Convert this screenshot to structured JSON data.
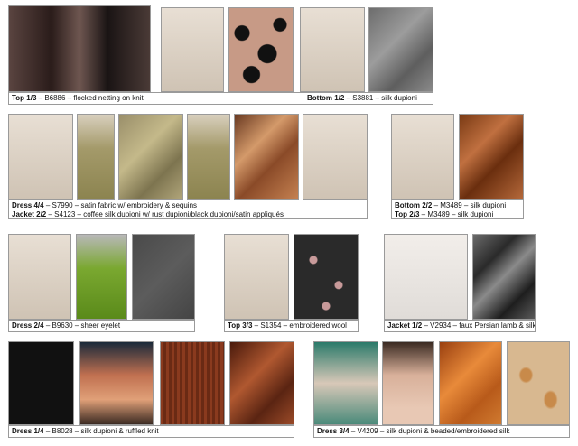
{
  "captions": {
    "top13": {
      "bold": "Top 1/3",
      "rest": " – B6886 – flocked netting on knit"
    },
    "bottom12": {
      "bold": "Bottom 1/2",
      "rest": " – S3881 – silk dupioni"
    },
    "dress44": {
      "bold": "Dress 4/4",
      "rest": " – S7990 – satin fabric w/ embroidery & sequins"
    },
    "jacket22": {
      "bold": "Jacket 2/2",
      "rest": " – S4123 – coffee silk dupioni w/ rust dupioni/black dupioni/satin appliqués"
    },
    "bottom22": {
      "bold": "Bottom 2/2",
      "rest": " – M3489 – silk dupioni"
    },
    "top23": {
      "bold": "Top 2/3",
      "rest": " – M3489 – silk dupioni"
    },
    "dress24": {
      "bold": "Dress 2/4",
      "rest": " – B9630 – sheer eyelet"
    },
    "top33": {
      "bold": "Top 3/3",
      "rest": " – S1354 – embroidered wool"
    },
    "jacket12": {
      "bold": "Jacket 1/2",
      "rest": " – V2934 – faux Persian lamb & silk"
    },
    "dress14": {
      "bold": "Dress 1/4",
      "rest": " – B8028 – silk dupioni & ruffled knit"
    },
    "dress34": {
      "bold": "Dress 3/4",
      "rest": " – V4209 – silk dupioni & beaded/embroidered silk"
    }
  },
  "colors": {
    "border": "#9a9a9a",
    "background": "#ffffff"
  }
}
